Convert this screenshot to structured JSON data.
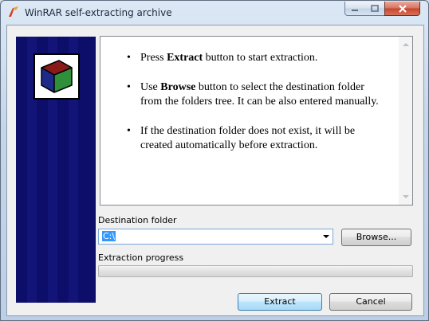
{
  "window": {
    "title": "WinRAR self-extracting archive",
    "icon": "winrar-icon"
  },
  "title_bar_controls": [
    "minimize-icon",
    "maximize-icon",
    "close-icon"
  ],
  "side_panel": {
    "logo_icon": "winrar-books-icon",
    "background_color": "#0c0e6a"
  },
  "info": {
    "items": [
      {
        "bullet": "•",
        "before": "Press ",
        "bold": "Extract",
        "after": " button to start extraction."
      },
      {
        "bullet": "•",
        "before": "Use ",
        "bold": "Browse",
        "after": " button to select the destination folder from the folders tree. It can be also entered manually."
      },
      {
        "bullet": "•",
        "before": "If the destination folder does not exist, it will be created automatically before extraction.",
        "bold": "",
        "after": ""
      }
    ]
  },
  "destination": {
    "label": "Destination folder",
    "value": "C:\\",
    "browse_label": "Browse..."
  },
  "progress": {
    "label": "Extraction progress",
    "percent": 0
  },
  "buttons": {
    "extract_label": "Extract",
    "cancel_label": "Cancel"
  },
  "colors": {
    "accent": "#3c7fb1",
    "selection": "#3399ff",
    "progress_fill": "#06b025"
  }
}
